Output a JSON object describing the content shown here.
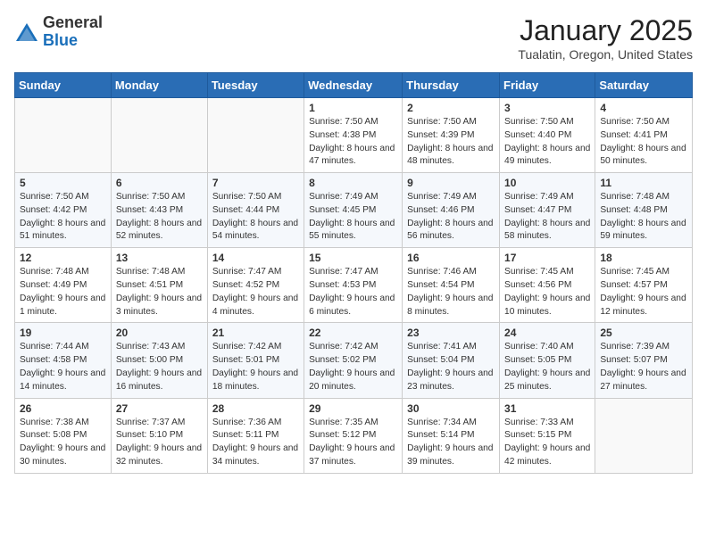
{
  "header": {
    "logo_general": "General",
    "logo_blue": "Blue",
    "month_title": "January 2025",
    "location": "Tualatin, Oregon, United States"
  },
  "weekdays": [
    "Sunday",
    "Monday",
    "Tuesday",
    "Wednesday",
    "Thursday",
    "Friday",
    "Saturday"
  ],
  "weeks": [
    [
      {
        "day": "",
        "sunrise": "",
        "sunset": "",
        "daylight": ""
      },
      {
        "day": "",
        "sunrise": "",
        "sunset": "",
        "daylight": ""
      },
      {
        "day": "",
        "sunrise": "",
        "sunset": "",
        "daylight": ""
      },
      {
        "day": "1",
        "sunrise": "Sunrise: 7:50 AM",
        "sunset": "Sunset: 4:38 PM",
        "daylight": "Daylight: 8 hours and 47 minutes."
      },
      {
        "day": "2",
        "sunrise": "Sunrise: 7:50 AM",
        "sunset": "Sunset: 4:39 PM",
        "daylight": "Daylight: 8 hours and 48 minutes."
      },
      {
        "day": "3",
        "sunrise": "Sunrise: 7:50 AM",
        "sunset": "Sunset: 4:40 PM",
        "daylight": "Daylight: 8 hours and 49 minutes."
      },
      {
        "day": "4",
        "sunrise": "Sunrise: 7:50 AM",
        "sunset": "Sunset: 4:41 PM",
        "daylight": "Daylight: 8 hours and 50 minutes."
      }
    ],
    [
      {
        "day": "5",
        "sunrise": "Sunrise: 7:50 AM",
        "sunset": "Sunset: 4:42 PM",
        "daylight": "Daylight: 8 hours and 51 minutes."
      },
      {
        "day": "6",
        "sunrise": "Sunrise: 7:50 AM",
        "sunset": "Sunset: 4:43 PM",
        "daylight": "Daylight: 8 hours and 52 minutes."
      },
      {
        "day": "7",
        "sunrise": "Sunrise: 7:50 AM",
        "sunset": "Sunset: 4:44 PM",
        "daylight": "Daylight: 8 hours and 54 minutes."
      },
      {
        "day": "8",
        "sunrise": "Sunrise: 7:49 AM",
        "sunset": "Sunset: 4:45 PM",
        "daylight": "Daylight: 8 hours and 55 minutes."
      },
      {
        "day": "9",
        "sunrise": "Sunrise: 7:49 AM",
        "sunset": "Sunset: 4:46 PM",
        "daylight": "Daylight: 8 hours and 56 minutes."
      },
      {
        "day": "10",
        "sunrise": "Sunrise: 7:49 AM",
        "sunset": "Sunset: 4:47 PM",
        "daylight": "Daylight: 8 hours and 58 minutes."
      },
      {
        "day": "11",
        "sunrise": "Sunrise: 7:48 AM",
        "sunset": "Sunset: 4:48 PM",
        "daylight": "Daylight: 8 hours and 59 minutes."
      }
    ],
    [
      {
        "day": "12",
        "sunrise": "Sunrise: 7:48 AM",
        "sunset": "Sunset: 4:49 PM",
        "daylight": "Daylight: 9 hours and 1 minute."
      },
      {
        "day": "13",
        "sunrise": "Sunrise: 7:48 AM",
        "sunset": "Sunset: 4:51 PM",
        "daylight": "Daylight: 9 hours and 3 minutes."
      },
      {
        "day": "14",
        "sunrise": "Sunrise: 7:47 AM",
        "sunset": "Sunset: 4:52 PM",
        "daylight": "Daylight: 9 hours and 4 minutes."
      },
      {
        "day": "15",
        "sunrise": "Sunrise: 7:47 AM",
        "sunset": "Sunset: 4:53 PM",
        "daylight": "Daylight: 9 hours and 6 minutes."
      },
      {
        "day": "16",
        "sunrise": "Sunrise: 7:46 AM",
        "sunset": "Sunset: 4:54 PM",
        "daylight": "Daylight: 9 hours and 8 minutes."
      },
      {
        "day": "17",
        "sunrise": "Sunrise: 7:45 AM",
        "sunset": "Sunset: 4:56 PM",
        "daylight": "Daylight: 9 hours and 10 minutes."
      },
      {
        "day": "18",
        "sunrise": "Sunrise: 7:45 AM",
        "sunset": "Sunset: 4:57 PM",
        "daylight": "Daylight: 9 hours and 12 minutes."
      }
    ],
    [
      {
        "day": "19",
        "sunrise": "Sunrise: 7:44 AM",
        "sunset": "Sunset: 4:58 PM",
        "daylight": "Daylight: 9 hours and 14 minutes."
      },
      {
        "day": "20",
        "sunrise": "Sunrise: 7:43 AM",
        "sunset": "Sunset: 5:00 PM",
        "daylight": "Daylight: 9 hours and 16 minutes."
      },
      {
        "day": "21",
        "sunrise": "Sunrise: 7:42 AM",
        "sunset": "Sunset: 5:01 PM",
        "daylight": "Daylight: 9 hours and 18 minutes."
      },
      {
        "day": "22",
        "sunrise": "Sunrise: 7:42 AM",
        "sunset": "Sunset: 5:02 PM",
        "daylight": "Daylight: 9 hours and 20 minutes."
      },
      {
        "day": "23",
        "sunrise": "Sunrise: 7:41 AM",
        "sunset": "Sunset: 5:04 PM",
        "daylight": "Daylight: 9 hours and 23 minutes."
      },
      {
        "day": "24",
        "sunrise": "Sunrise: 7:40 AM",
        "sunset": "Sunset: 5:05 PM",
        "daylight": "Daylight: 9 hours and 25 minutes."
      },
      {
        "day": "25",
        "sunrise": "Sunrise: 7:39 AM",
        "sunset": "Sunset: 5:07 PM",
        "daylight": "Daylight: 9 hours and 27 minutes."
      }
    ],
    [
      {
        "day": "26",
        "sunrise": "Sunrise: 7:38 AM",
        "sunset": "Sunset: 5:08 PM",
        "daylight": "Daylight: 9 hours and 30 minutes."
      },
      {
        "day": "27",
        "sunrise": "Sunrise: 7:37 AM",
        "sunset": "Sunset: 5:10 PM",
        "daylight": "Daylight: 9 hours and 32 minutes."
      },
      {
        "day": "28",
        "sunrise": "Sunrise: 7:36 AM",
        "sunset": "Sunset: 5:11 PM",
        "daylight": "Daylight: 9 hours and 34 minutes."
      },
      {
        "day": "29",
        "sunrise": "Sunrise: 7:35 AM",
        "sunset": "Sunset: 5:12 PM",
        "daylight": "Daylight: 9 hours and 37 minutes."
      },
      {
        "day": "30",
        "sunrise": "Sunrise: 7:34 AM",
        "sunset": "Sunset: 5:14 PM",
        "daylight": "Daylight: 9 hours and 39 minutes."
      },
      {
        "day": "31",
        "sunrise": "Sunrise: 7:33 AM",
        "sunset": "Sunset: 5:15 PM",
        "daylight": "Daylight: 9 hours and 42 minutes."
      },
      {
        "day": "",
        "sunrise": "",
        "sunset": "",
        "daylight": ""
      }
    ]
  ]
}
